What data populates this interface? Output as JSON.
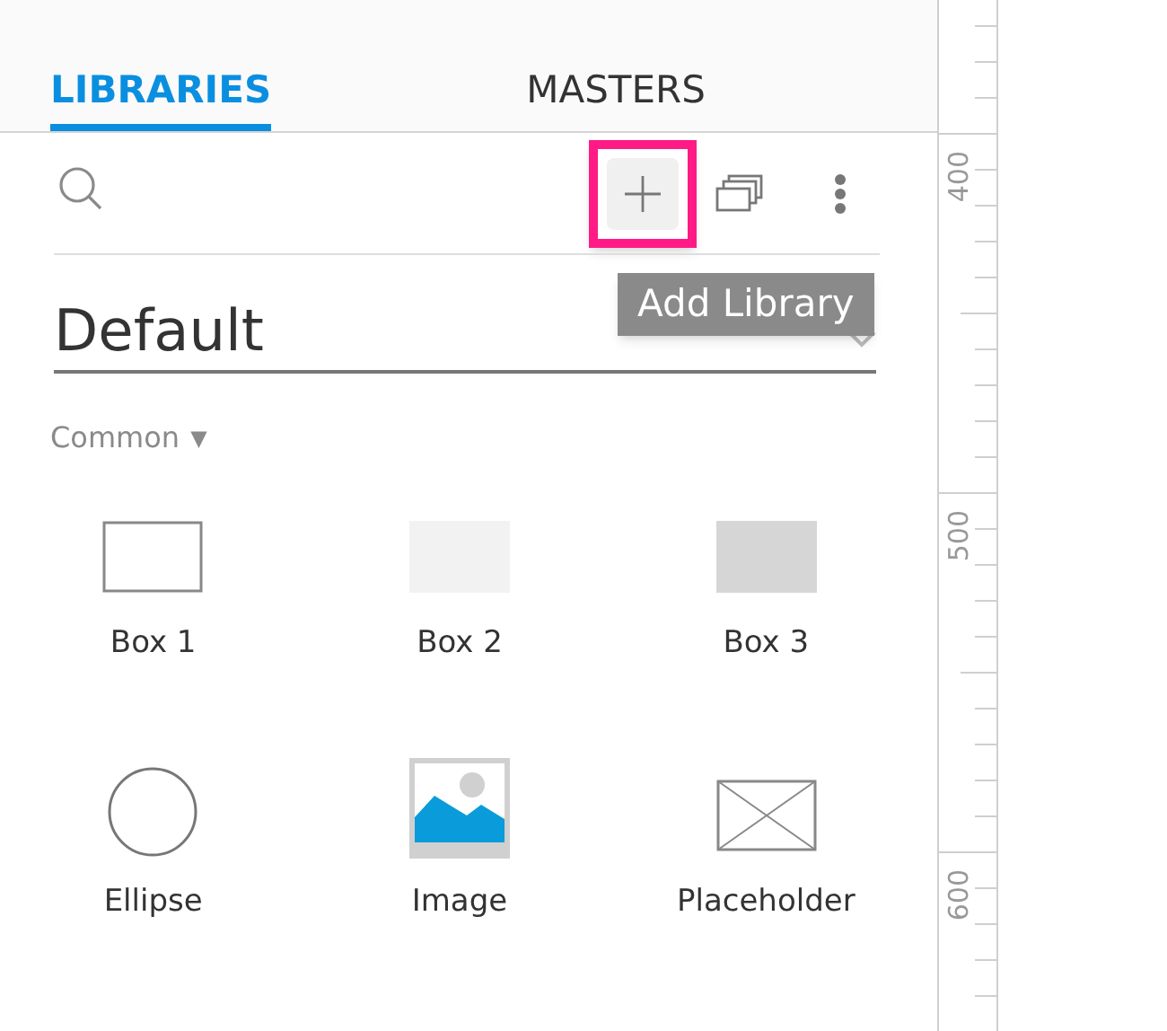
{
  "tabs": [
    {
      "label": "LIBRARIES",
      "selected": true
    },
    {
      "label": "MASTERS",
      "selected": false
    }
  ],
  "toolbar": {
    "add_button": {
      "highlighted": true
    },
    "tooltip": "Add Library"
  },
  "library_dropdown": {
    "value": "Default"
  },
  "category": {
    "label": "Common",
    "caret": "▼"
  },
  "widgets": [
    {
      "label": "Box 1",
      "kind": "box-outline"
    },
    {
      "label": "Box 2",
      "kind": "box-light"
    },
    {
      "label": "Box 3",
      "kind": "box-dark"
    },
    {
      "label": "Ellipse",
      "kind": "ellipse"
    },
    {
      "label": "Image",
      "kind": "image"
    },
    {
      "label": "Placeholder",
      "kind": "placeholder"
    }
  ],
  "ruler": {
    "labels": [
      "400",
      "500",
      "600"
    ]
  }
}
